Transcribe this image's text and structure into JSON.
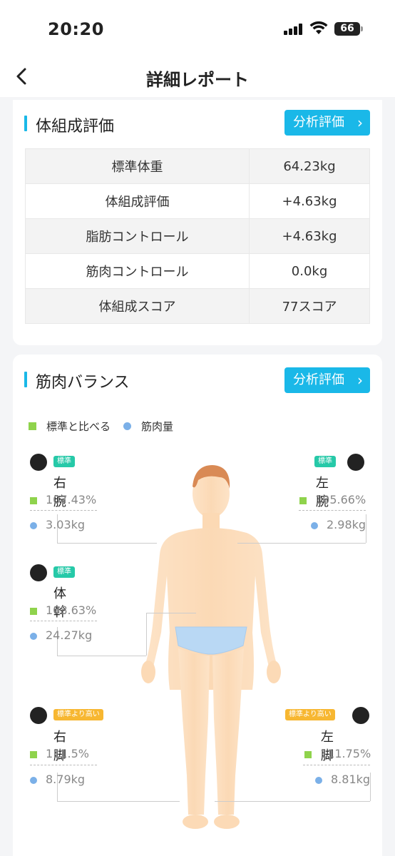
{
  "status_bar": {
    "time": "20:20",
    "battery": "66"
  },
  "nav": {
    "title": "詳細レポート"
  },
  "composition": {
    "title": "体組成評価",
    "button": "分析評価",
    "rows": [
      {
        "label": "標準体重",
        "value": "64.23kg"
      },
      {
        "label": "体組成評価",
        "value": "+4.63kg"
      },
      {
        "label": "脂肪コントロール",
        "value": "+4.63kg"
      },
      {
        "label": "筋肉コントロール",
        "value": "0.0kg"
      },
      {
        "label": "体組成スコア",
        "value": "77スコア"
      }
    ]
  },
  "balance": {
    "title": "筋肉バランス",
    "button": "分析評価",
    "legend": {
      "standard": "標準と比べる",
      "muscle": "筋肉量"
    },
    "parts": {
      "right_arm": {
        "name": "右腕",
        "badge": "標準",
        "pct": "107.43%",
        "kg": "3.03kg"
      },
      "left_arm": {
        "name": "左腕",
        "badge": "標準",
        "pct": "105.66%",
        "kg": "2.98kg"
      },
      "trunk": {
        "name": "体幹",
        "badge": "標準",
        "pct": "108.63%",
        "kg": "24.27kg"
      },
      "right_leg": {
        "name": "右脚",
        "badge": "標準より高い",
        "pct": "111.5%",
        "kg": "8.79kg"
      },
      "left_leg": {
        "name": "左脚",
        "badge": "標準より高い",
        "pct": "111.75%",
        "kg": "8.81kg"
      }
    }
  },
  "colors": {
    "accent": "#1ab8e8",
    "standard_green": "#8fd34c",
    "muscle_blue": "#7bb0e8",
    "badge_normal": "#26c9a8",
    "badge_high": "#f7b731"
  }
}
